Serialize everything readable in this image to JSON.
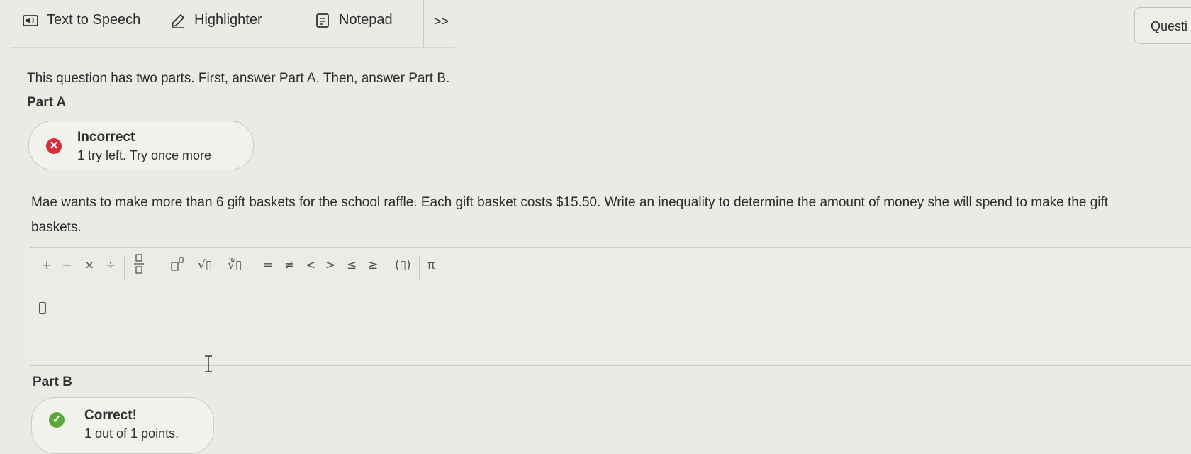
{
  "toolbar": {
    "text_to_speech": "Text to Speech",
    "highlighter": "Highlighter",
    "notepad": "Notepad",
    "more": ">>",
    "question_button": "Questi"
  },
  "intro": "This question has two parts. First, answer Part A. Then, answer Part B.",
  "part_a": {
    "label": "Part A",
    "feedback": {
      "status": "Incorrect",
      "detail": "1 try left. Try once more",
      "color": "#d6303a"
    }
  },
  "question": "Mae wants to make more than 6 gift baskets for the school raffle. Each gift basket costs $15.50. Write an inequality to determine the amount of money she will spend to make the gift baskets.",
  "math_toolbar": [
    "+",
    "−",
    "×",
    "÷",
    "▯/▯",
    "▯▯",
    "√▯",
    "∛▯",
    "=",
    "≠",
    "<",
    ">",
    "≤",
    "≥",
    "(▯)",
    "π"
  ],
  "part_b": {
    "label": "Part B",
    "feedback": {
      "status": "Correct!",
      "detail": "1 out of 1 points.",
      "color": "#5aa83a"
    }
  }
}
